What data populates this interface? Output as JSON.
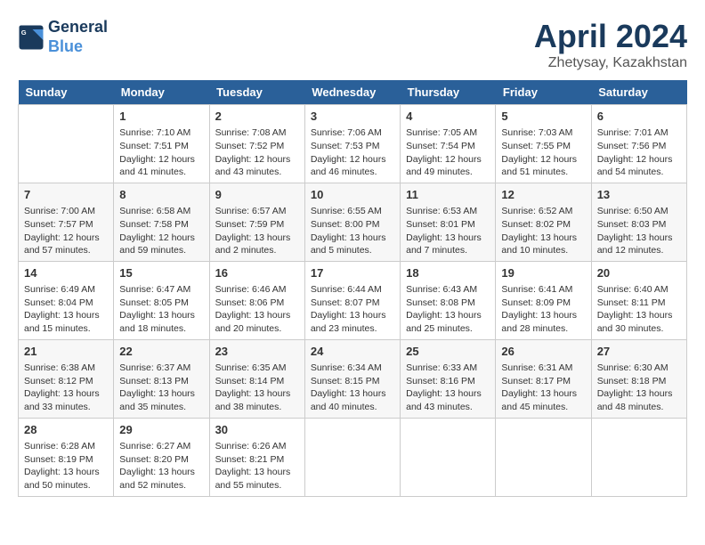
{
  "header": {
    "logo_line1": "General",
    "logo_line2": "Blue",
    "month": "April 2024",
    "location": "Zhetysay, Kazakhstan"
  },
  "weekdays": [
    "Sunday",
    "Monday",
    "Tuesday",
    "Wednesday",
    "Thursday",
    "Friday",
    "Saturday"
  ],
  "weeks": [
    [
      {
        "day": "",
        "info": ""
      },
      {
        "day": "1",
        "info": "Sunrise: 7:10 AM\nSunset: 7:51 PM\nDaylight: 12 hours\nand 41 minutes."
      },
      {
        "day": "2",
        "info": "Sunrise: 7:08 AM\nSunset: 7:52 PM\nDaylight: 12 hours\nand 43 minutes."
      },
      {
        "day": "3",
        "info": "Sunrise: 7:06 AM\nSunset: 7:53 PM\nDaylight: 12 hours\nand 46 minutes."
      },
      {
        "day": "4",
        "info": "Sunrise: 7:05 AM\nSunset: 7:54 PM\nDaylight: 12 hours\nand 49 minutes."
      },
      {
        "day": "5",
        "info": "Sunrise: 7:03 AM\nSunset: 7:55 PM\nDaylight: 12 hours\nand 51 minutes."
      },
      {
        "day": "6",
        "info": "Sunrise: 7:01 AM\nSunset: 7:56 PM\nDaylight: 12 hours\nand 54 minutes."
      }
    ],
    [
      {
        "day": "7",
        "info": "Sunrise: 7:00 AM\nSunset: 7:57 PM\nDaylight: 12 hours\nand 57 minutes."
      },
      {
        "day": "8",
        "info": "Sunrise: 6:58 AM\nSunset: 7:58 PM\nDaylight: 12 hours\nand 59 minutes."
      },
      {
        "day": "9",
        "info": "Sunrise: 6:57 AM\nSunset: 7:59 PM\nDaylight: 13 hours\nand 2 minutes."
      },
      {
        "day": "10",
        "info": "Sunrise: 6:55 AM\nSunset: 8:00 PM\nDaylight: 13 hours\nand 5 minutes."
      },
      {
        "day": "11",
        "info": "Sunrise: 6:53 AM\nSunset: 8:01 PM\nDaylight: 13 hours\nand 7 minutes."
      },
      {
        "day": "12",
        "info": "Sunrise: 6:52 AM\nSunset: 8:02 PM\nDaylight: 13 hours\nand 10 minutes."
      },
      {
        "day": "13",
        "info": "Sunrise: 6:50 AM\nSunset: 8:03 PM\nDaylight: 13 hours\nand 12 minutes."
      }
    ],
    [
      {
        "day": "14",
        "info": "Sunrise: 6:49 AM\nSunset: 8:04 PM\nDaylight: 13 hours\nand 15 minutes."
      },
      {
        "day": "15",
        "info": "Sunrise: 6:47 AM\nSunset: 8:05 PM\nDaylight: 13 hours\nand 18 minutes."
      },
      {
        "day": "16",
        "info": "Sunrise: 6:46 AM\nSunset: 8:06 PM\nDaylight: 13 hours\nand 20 minutes."
      },
      {
        "day": "17",
        "info": "Sunrise: 6:44 AM\nSunset: 8:07 PM\nDaylight: 13 hours\nand 23 minutes."
      },
      {
        "day": "18",
        "info": "Sunrise: 6:43 AM\nSunset: 8:08 PM\nDaylight: 13 hours\nand 25 minutes."
      },
      {
        "day": "19",
        "info": "Sunrise: 6:41 AM\nSunset: 8:09 PM\nDaylight: 13 hours\nand 28 minutes."
      },
      {
        "day": "20",
        "info": "Sunrise: 6:40 AM\nSunset: 8:11 PM\nDaylight: 13 hours\nand 30 minutes."
      }
    ],
    [
      {
        "day": "21",
        "info": "Sunrise: 6:38 AM\nSunset: 8:12 PM\nDaylight: 13 hours\nand 33 minutes."
      },
      {
        "day": "22",
        "info": "Sunrise: 6:37 AM\nSunset: 8:13 PM\nDaylight: 13 hours\nand 35 minutes."
      },
      {
        "day": "23",
        "info": "Sunrise: 6:35 AM\nSunset: 8:14 PM\nDaylight: 13 hours\nand 38 minutes."
      },
      {
        "day": "24",
        "info": "Sunrise: 6:34 AM\nSunset: 8:15 PM\nDaylight: 13 hours\nand 40 minutes."
      },
      {
        "day": "25",
        "info": "Sunrise: 6:33 AM\nSunset: 8:16 PM\nDaylight: 13 hours\nand 43 minutes."
      },
      {
        "day": "26",
        "info": "Sunrise: 6:31 AM\nSunset: 8:17 PM\nDaylight: 13 hours\nand 45 minutes."
      },
      {
        "day": "27",
        "info": "Sunrise: 6:30 AM\nSunset: 8:18 PM\nDaylight: 13 hours\nand 48 minutes."
      }
    ],
    [
      {
        "day": "28",
        "info": "Sunrise: 6:28 AM\nSunset: 8:19 PM\nDaylight: 13 hours\nand 50 minutes."
      },
      {
        "day": "29",
        "info": "Sunrise: 6:27 AM\nSunset: 8:20 PM\nDaylight: 13 hours\nand 52 minutes."
      },
      {
        "day": "30",
        "info": "Sunrise: 6:26 AM\nSunset: 8:21 PM\nDaylight: 13 hours\nand 55 minutes."
      },
      {
        "day": "",
        "info": ""
      },
      {
        "day": "",
        "info": ""
      },
      {
        "day": "",
        "info": ""
      },
      {
        "day": "",
        "info": ""
      }
    ]
  ]
}
